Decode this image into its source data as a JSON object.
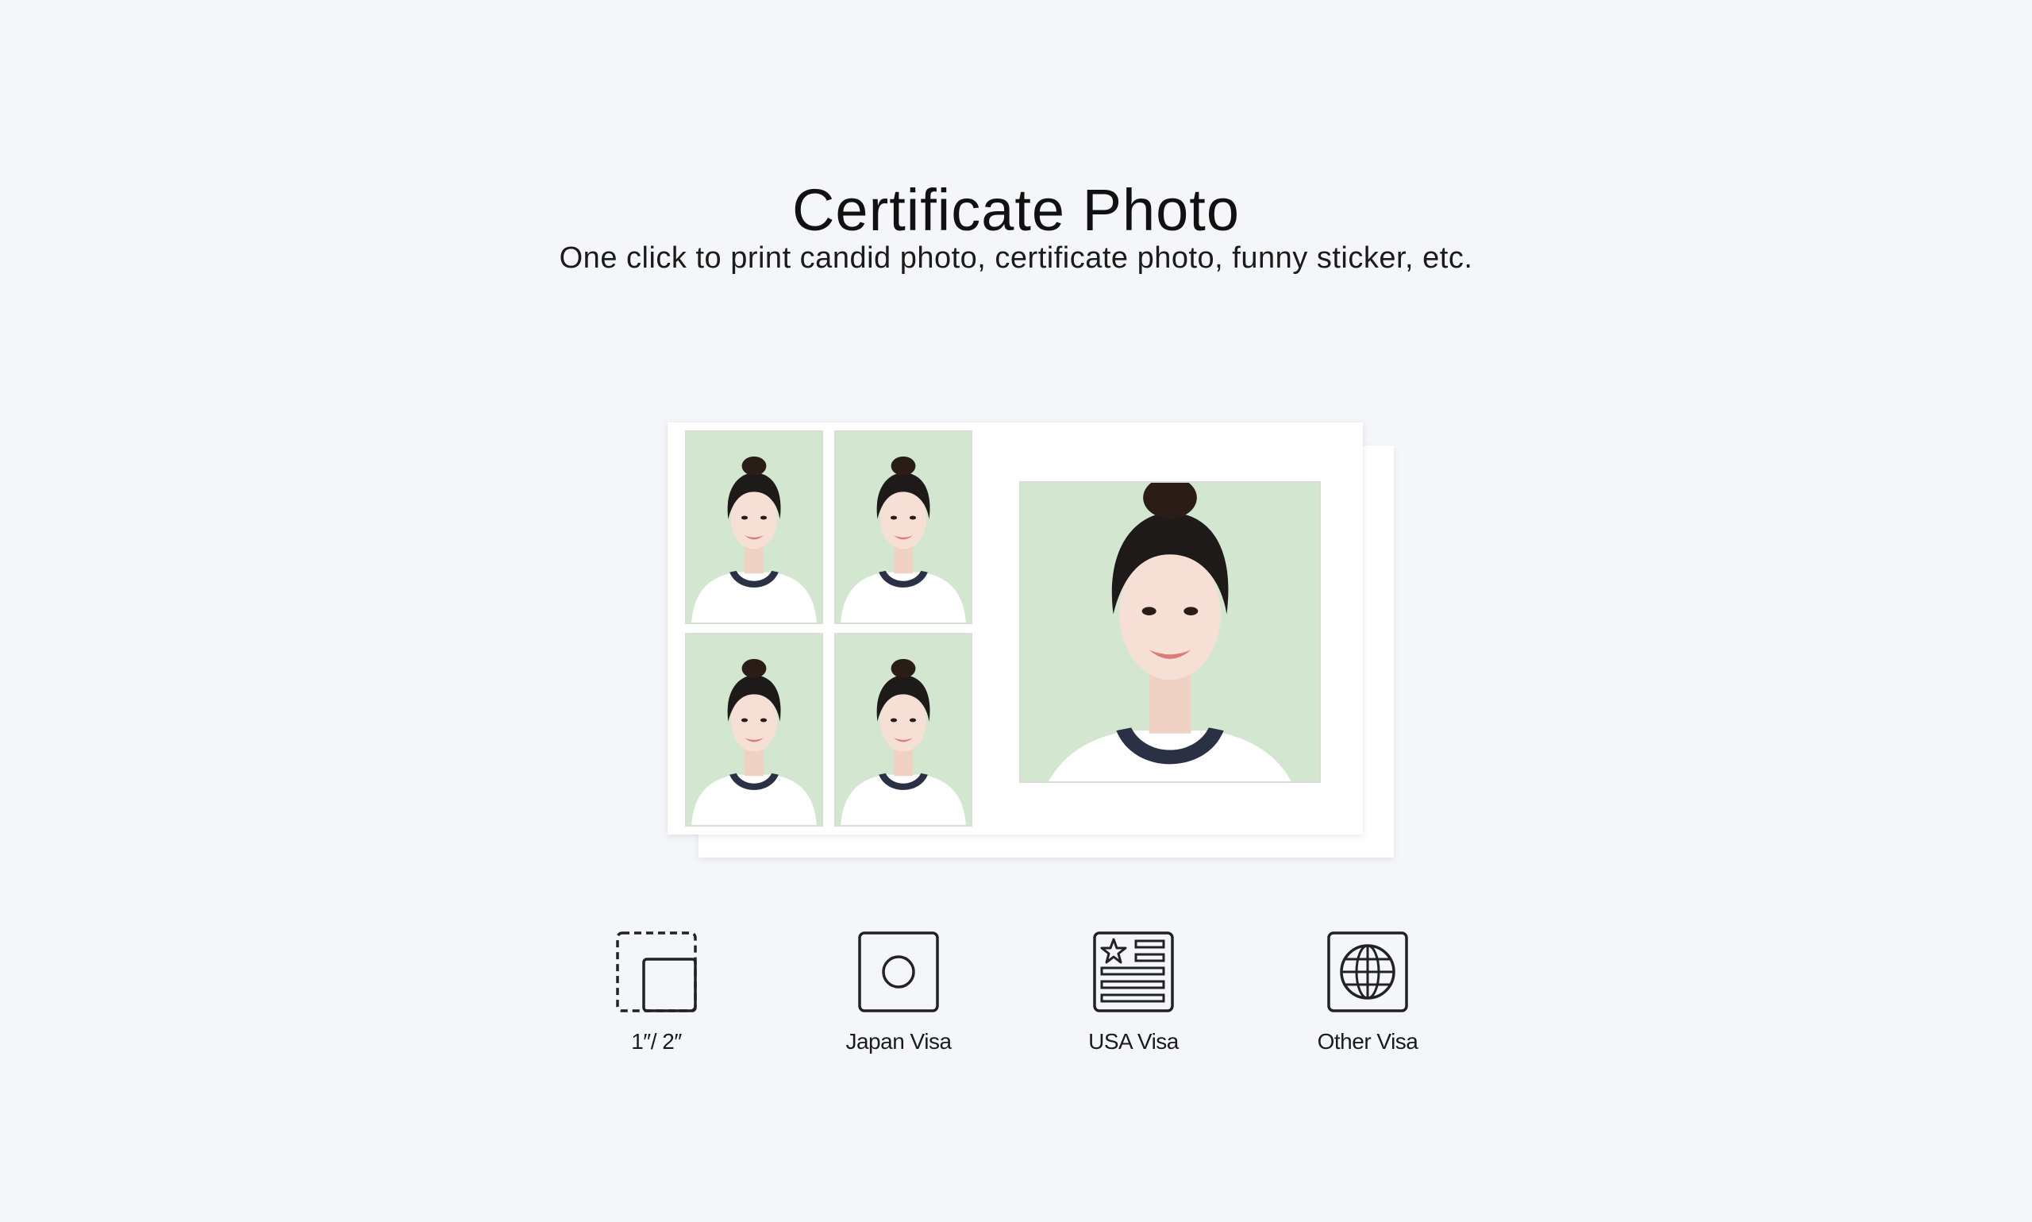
{
  "header": {
    "title": "Certificate Photo",
    "subtitle": "One click to print candid photo, certificate photo, funny sticker, etc."
  },
  "sheet": {
    "photo_background_color": "#d3e6d0",
    "small_photo_count": 4,
    "large_photo_count": 1
  },
  "options": [
    {
      "label": "1″/ 2″",
      "icon": "photo-size-icon"
    },
    {
      "label": "Japan Visa",
      "icon": "japan-flag-icon"
    },
    {
      "label": "USA Visa",
      "icon": "usa-flag-icon"
    },
    {
      "label": "Other Visa",
      "icon": "globe-icon"
    }
  ]
}
